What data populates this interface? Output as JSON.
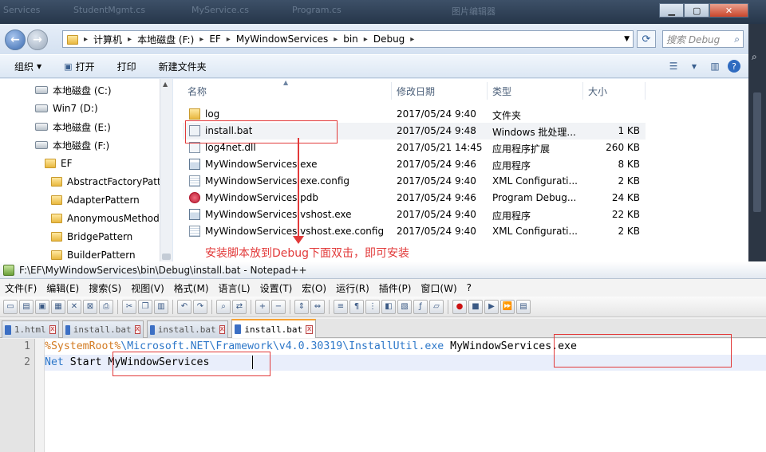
{
  "background_windows": {
    "tabs": [
      "Services",
      "StudentMgmt.cs",
      "MyService.cs",
      "Program.cs",
      "图片编辑器"
    ]
  },
  "explorer": {
    "breadcrumb": [
      "计算机",
      "本地磁盘 (F:)",
      "EF",
      "MyWindowServices",
      "bin",
      "Debug"
    ],
    "search_placeholder": "搜索 Debug",
    "toolbar": {
      "organize": "组织",
      "open": "打开",
      "print": "打印",
      "new_folder": "新建文件夹"
    },
    "nav_items": [
      {
        "label": "本地磁盘 (C:)",
        "type": "drive"
      },
      {
        "label": "Win7 (D:)",
        "type": "drive"
      },
      {
        "label": "本地磁盘 (E:)",
        "type": "drive"
      },
      {
        "label": "本地磁盘 (F:)",
        "type": "drive"
      },
      {
        "label": "EF",
        "type": "folder"
      },
      {
        "label": "AbstractFactoryPatte",
        "type": "folder"
      },
      {
        "label": "AdapterPattern",
        "type": "folder"
      },
      {
        "label": "AnonymousMethod",
        "type": "folder"
      },
      {
        "label": "BridgePattern",
        "type": "folder"
      },
      {
        "label": "BuilderPattern",
        "type": "folder"
      }
    ],
    "columns": {
      "name": "名称",
      "date": "修改日期",
      "type": "类型",
      "size": "大小"
    },
    "files": [
      {
        "name": "log",
        "date": "2017/05/24 9:40",
        "type": "文件夹",
        "size": "",
        "icon": "folder-icon"
      },
      {
        "name": "install.bat",
        "date": "2017/05/24 9:48",
        "type": "Windows 批处理...",
        "size": "1 KB",
        "icon": "bat-file-icon"
      },
      {
        "name": "log4net.dll",
        "date": "2017/05/21 14:45",
        "type": "应用程序扩展",
        "size": "260 KB",
        "icon": "dll-file-icon"
      },
      {
        "name": "MyWindowServices.exe",
        "date": "2017/05/24 9:46",
        "type": "应用程序",
        "size": "8 KB",
        "icon": "exe-file-icon"
      },
      {
        "name": "MyWindowServices.exe.config",
        "date": "2017/05/24 9:40",
        "type": "XML Configurati...",
        "size": "2 KB",
        "icon": "config-file-icon"
      },
      {
        "name": "MyWindowServices.pdb",
        "date": "2017/05/24 9:46",
        "type": "Program Debug...",
        "size": "24 KB",
        "icon": "pdb-file-icon"
      },
      {
        "name": "MyWindowServices.vshost.exe",
        "date": "2017/05/24 9:40",
        "type": "应用程序",
        "size": "22 KB",
        "icon": "exe-file-icon"
      },
      {
        "name": "MyWindowServices.vshost.exe.config",
        "date": "2017/05/24 9:40",
        "type": "XML Configurati...",
        "size": "2 KB",
        "icon": "config-file-icon"
      }
    ]
  },
  "annotation": {
    "text": "安装脚本放到Debug下面双击，即可安装",
    "color": "#e23a3a"
  },
  "notepad": {
    "title": "F:\\EF\\MyWindowServices\\bin\\Debug\\install.bat - Notepad++",
    "menu": [
      "文件(F)",
      "编辑(E)",
      "搜索(S)",
      "视图(V)",
      "格式(M)",
      "语言(L)",
      "设置(T)",
      "宏(O)",
      "运行(R)",
      "插件(P)",
      "窗口(W)",
      "?"
    ],
    "tabs": [
      "1.html",
      "install.bat",
      "install.bat",
      "install.bat"
    ],
    "active_tab_index": 3,
    "lines": [
      {
        "number": "1",
        "env": "%SystemRoot%",
        "path": "\\Microsoft.NET\\Framework\\v4.0.30319\\InstallUtil.exe",
        "arg": " MyWindowServices.exe"
      },
      {
        "number": "2",
        "keyword": "Net",
        "rest": " Start MyWindowServices"
      }
    ]
  }
}
